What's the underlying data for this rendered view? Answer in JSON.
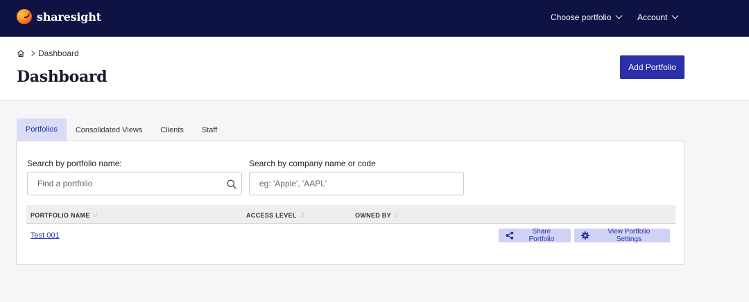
{
  "topbar": {
    "logo_text": "sharesight",
    "choose_portfolio": "Choose portfolio",
    "account": "Account"
  },
  "header": {
    "breadcrumb_current": "Dashboard",
    "title": "Dashboard",
    "add_portfolio": "Add Portfolio"
  },
  "tabs": [
    {
      "label": "Portfolios",
      "active": true
    },
    {
      "label": "Consolidated Views",
      "active": false
    },
    {
      "label": "Clients",
      "active": false
    },
    {
      "label": "Staff",
      "active": false
    }
  ],
  "search": {
    "portfolio_label": "Search by portfolio name:",
    "portfolio_placeholder": "Find a portfolio",
    "company_label": "Search by company name or code",
    "company_placeholder": "eg: 'Apple', 'AAPL'"
  },
  "table": {
    "columns": [
      "PORTFOLIO NAME",
      "ACCESS LEVEL",
      "OWNED BY"
    ],
    "sort_glyph": "↓↑",
    "rows": [
      {
        "name": "Test 001",
        "access_level": "",
        "owned_by": ""
      }
    ]
  },
  "actions": {
    "share": "Share Portfolio",
    "settings": "View Portfolio Settings"
  },
  "colors": {
    "nav_bg": "#0f1344",
    "accent": "#2b2fa8",
    "tab_active_bg": "#d9dcf7",
    "action_bg": "#cfd2f5"
  }
}
